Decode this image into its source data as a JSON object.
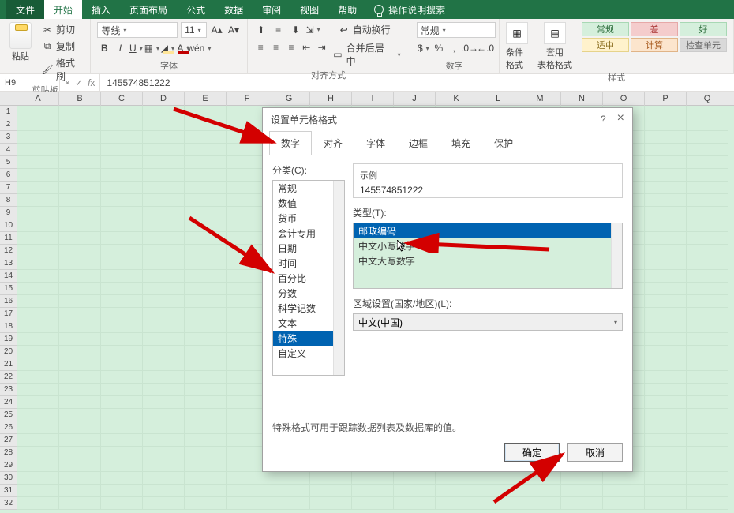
{
  "tabs": {
    "file": "文件",
    "home": "开始",
    "insert": "插入",
    "layout": "页面布局",
    "formula": "公式",
    "data": "数据",
    "review": "审阅",
    "view": "视图",
    "help": "帮助",
    "tell_me": "操作说明搜索"
  },
  "ribbon": {
    "clipboard": {
      "cut": "剪切",
      "copy": "复制",
      "format_painter": "格式刷",
      "label": "剪贴板",
      "paste": "粘贴"
    },
    "font": {
      "family": "等线",
      "size": "11",
      "label": "字体",
      "bold": "B",
      "italic": "I",
      "underline": "U"
    },
    "alignment": {
      "wrap": "自动换行",
      "merge": "合并后居中",
      "label": "对齐方式"
    },
    "number": {
      "format": "常规",
      "label": "数字"
    },
    "styles": {
      "cond": "条件格式",
      "table": "套用\n表格格式",
      "label": "样式",
      "cells": {
        "normal": "常规",
        "bad": "差",
        "good": "好",
        "neutral": "适中",
        "calc": "计算",
        "check": "检查单元"
      }
    }
  },
  "name_box": "H9",
  "fx_value": "145574851222",
  "cols": [
    "A",
    "B",
    "C",
    "D",
    "E",
    "F",
    "G",
    "H",
    "I",
    "J",
    "K",
    "L",
    "M",
    "N",
    "O",
    "P",
    "Q"
  ],
  "rows": [
    "1",
    "2",
    "3",
    "4",
    "5",
    "6",
    "7",
    "8",
    "9",
    "10",
    "11",
    "12",
    "13",
    "14",
    "15",
    "16",
    "17",
    "18",
    "19",
    "20",
    "21",
    "22",
    "23",
    "24",
    "25",
    "26",
    "27",
    "28",
    "29",
    "30",
    "31",
    "32"
  ],
  "dialog": {
    "title": "设置单元格格式",
    "help": "?",
    "close": "×",
    "tabs": {
      "number": "数字",
      "align": "对齐",
      "font": "字体",
      "border": "边框",
      "fill": "填充",
      "protect": "保护"
    },
    "category_label": "分类(C):",
    "categories": [
      "常规",
      "数值",
      "货币",
      "会计专用",
      "日期",
      "时间",
      "百分比",
      "分数",
      "科学记数",
      "文本",
      "特殊",
      "自定义"
    ],
    "category_selected": "特殊",
    "sample_label": "示例",
    "sample_value": "145574851222",
    "type_label": "类型(T):",
    "types": [
      "邮政编码",
      "中文小写数字",
      "中文大写数字"
    ],
    "type_selected": "邮政编码",
    "locale_label": "区域设置(国家/地区)(L):",
    "locale_value": "中文(中国)",
    "note": "特殊格式可用于跟踪数据列表及数据库的值。",
    "ok": "确定",
    "cancel": "取消"
  }
}
